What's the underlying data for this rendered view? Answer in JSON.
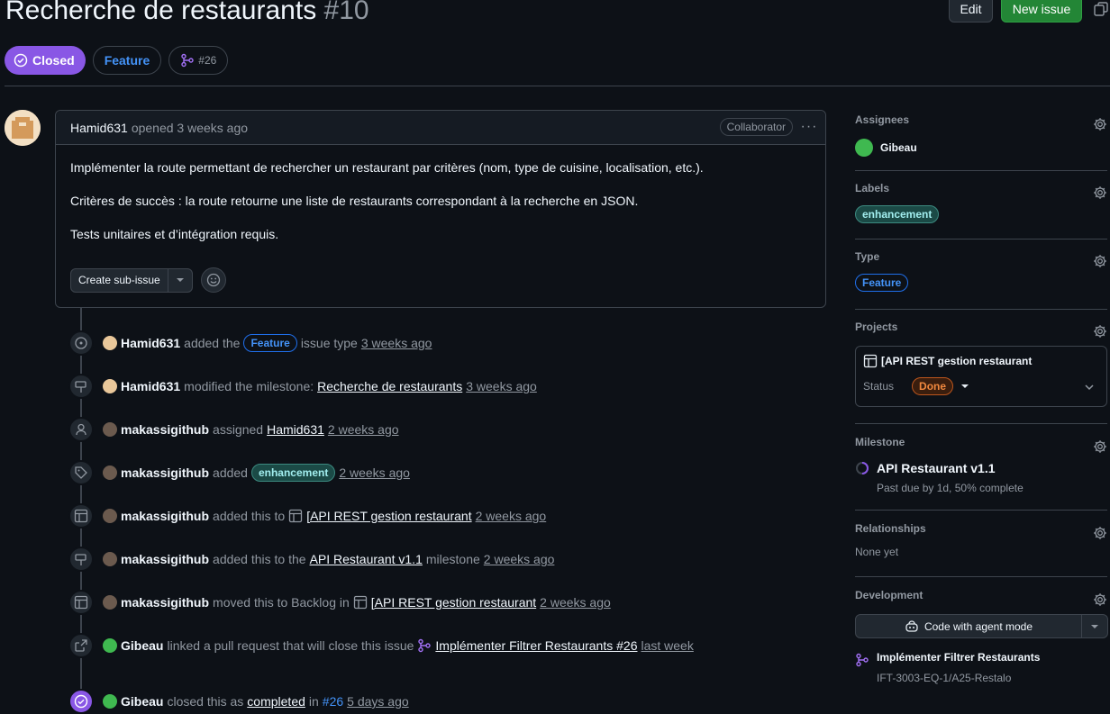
{
  "issue": {
    "title": "Recherche de restaurants",
    "number": "#10",
    "state": "Closed",
    "type": "Feature",
    "linked_pr": "#26"
  },
  "header": {
    "edit_label": "Edit",
    "new_issue_label": "New issue"
  },
  "comment": {
    "author": "Hamid631",
    "opened": "opened 3 weeks ago",
    "role": "Collaborator",
    "paragraphs": [
      "Implémenter la route permettant de rechercher un restaurant par critères (nom, type de cuisine, localisation, etc.).",
      "Critères de succès : la route retourne une liste de restaurants correspondant à la recherche en JSON.",
      "Tests unitaires et d’intégration requis."
    ],
    "create_sub_issue_label": "Create sub-issue"
  },
  "timeline": [
    {
      "actor": "Hamid631",
      "pre": "added the",
      "label": "Feature",
      "post": "issue type",
      "time": "3 weeks ago"
    },
    {
      "actor": "Hamid631",
      "pre": "modified the milestone:",
      "link": "Recherche de restaurants",
      "time": "3 weeks ago"
    },
    {
      "actor": "makassigithub",
      "pre": "assigned",
      "link": "Hamid631",
      "time": "2 weeks ago"
    },
    {
      "actor": "makassigithub",
      "pre": "added",
      "label": "enhancement",
      "time": "2 weeks ago"
    },
    {
      "actor": "makassigithub",
      "pre": "added this to",
      "link": "[API REST gestion restaurant",
      "time": "2 weeks ago"
    },
    {
      "actor": "makassigithub",
      "pre": "added this to the",
      "link": "API Restaurant v1.1",
      "post": "milestone",
      "time": "2 weeks ago"
    },
    {
      "actor": "makassigithub",
      "pre": "moved this to Backlog in",
      "link": "[API REST gestion restaurant",
      "time": "2 weeks ago"
    },
    {
      "actor": "Gibeau",
      "pre": "linked a pull request that will close this issue",
      "link": "Implémenter Filtrer Restaurants #26",
      "time": "last week"
    },
    {
      "actor": "Gibeau",
      "pre": "closed this as",
      "link": "completed",
      "post": "in",
      "ref": "#26",
      "time": "5 days ago"
    }
  ],
  "sidebar": {
    "assignees": {
      "heading": "Assignees",
      "name": "Gibeau"
    },
    "labels": {
      "heading": "Labels",
      "value": "enhancement"
    },
    "type": {
      "heading": "Type",
      "value": "Feature"
    },
    "projects": {
      "heading": "Projects",
      "name": "[API REST gestion restaurant",
      "status_label": "Status",
      "status": "Done"
    },
    "milestone": {
      "heading": "Milestone",
      "name": "API Restaurant v1.1",
      "detail": "Past due by 1d, 50% complete",
      "progress": 0.5
    },
    "relationships": {
      "heading": "Relationships",
      "value": "None yet"
    },
    "development": {
      "heading": "Development",
      "agent_label": "Code with agent mode",
      "pr_title": "Implémenter Filtrer Restaurants",
      "pr_repo": "IFT-3003-EQ-1/A25-Restalo"
    }
  },
  "colors": {
    "closed": "#8957e5",
    "new_issue": "#238636",
    "feature": "#4493f8",
    "done": "#f0883e"
  }
}
